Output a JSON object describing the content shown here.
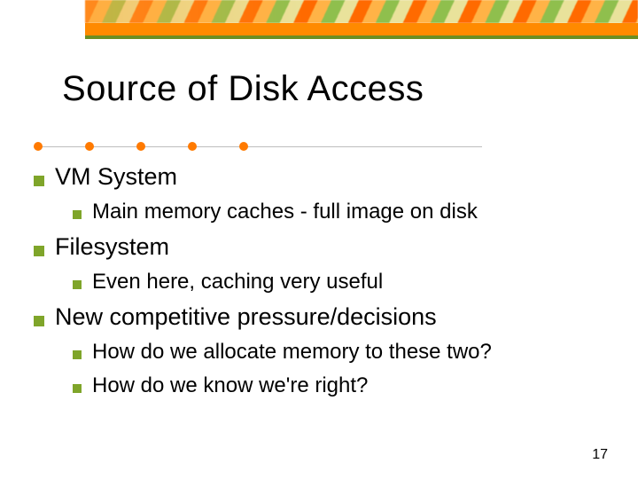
{
  "title": "Source of Disk Access",
  "bullets": {
    "b1": {
      "text": "VM System",
      "sub": {
        "s1": "Main memory caches - full image on disk"
      }
    },
    "b2": {
      "text": "Filesystem",
      "sub": {
        "s1": "Even here, caching very useful"
      }
    },
    "b3": {
      "text": "New competitive pressure/decisions",
      "sub": {
        "s1": "How do we allocate memory to these two?",
        "s2": "How do we know we're right?"
      }
    }
  },
  "page_number": "17"
}
